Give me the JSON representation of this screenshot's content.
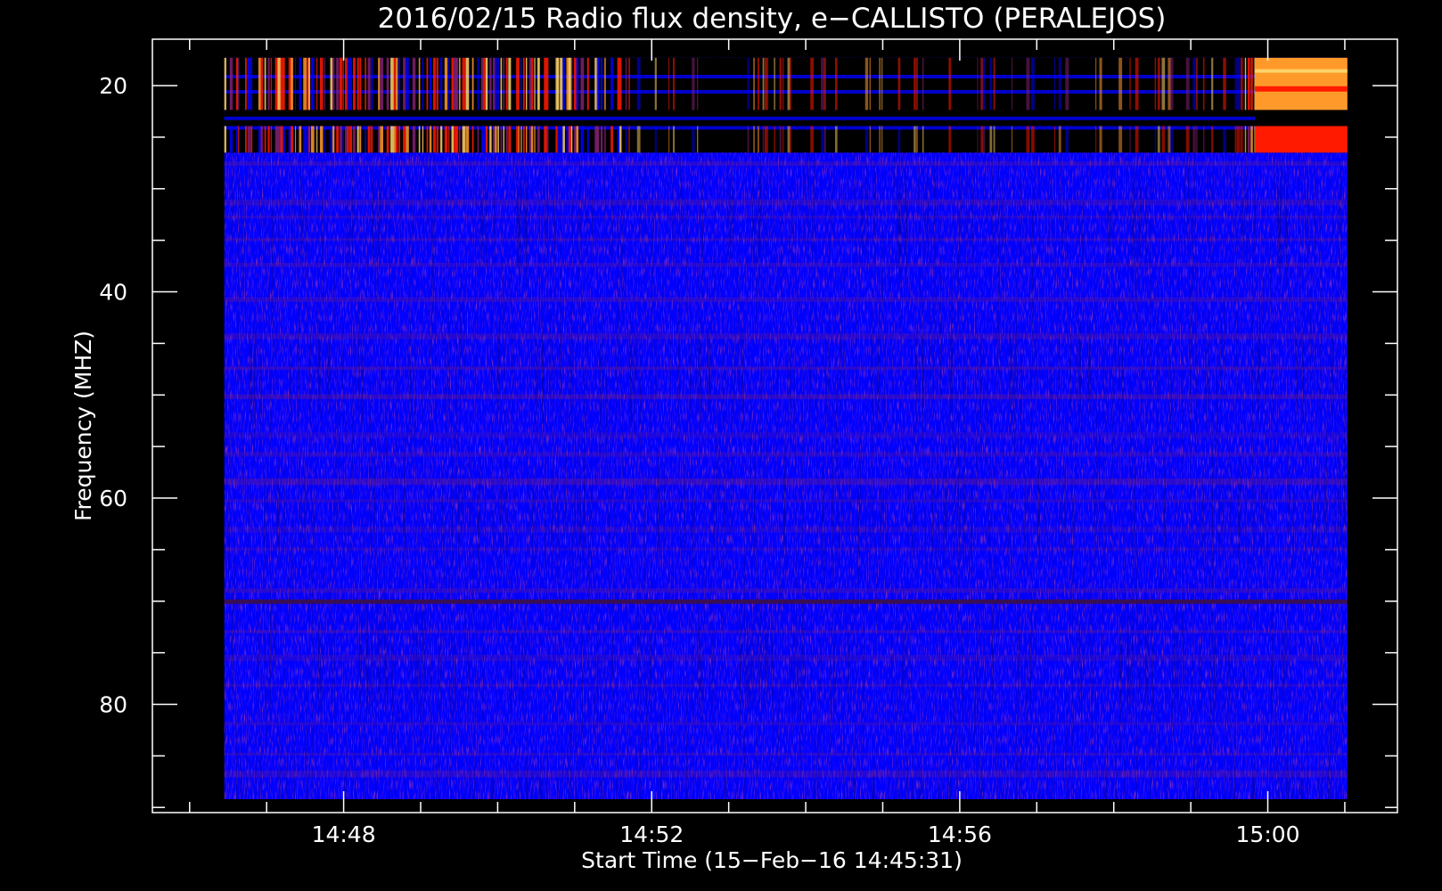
{
  "chart_data": {
    "type": "heatmap",
    "title": "2016/02/15  Radio flux density, e−CALLISTO (PERALEJOS)",
    "xlabel": "Start Time (15−Feb−16 14:45:31)",
    "ylabel": "Frequency (MHZ)",
    "x_axis": {
      "type": "time",
      "range": [
        "14:45:31",
        "15:01:41"
      ],
      "ticks": [
        "14:48",
        "14:52",
        "14:56",
        "15:00"
      ],
      "data_range": [
        "14:46:27",
        "15:01:02"
      ]
    },
    "y_axis": {
      "range": [
        15.5,
        90.5
      ],
      "inverted": true,
      "ticks": [
        20,
        40,
        60,
        80
      ],
      "minor_step": 5,
      "data_range": [
        17.3,
        89.2
      ]
    },
    "colormap": [
      "#000000",
      "#0000ff",
      "#7f2070",
      "#ff1a00",
      "#ff9a2a",
      "#ffd36a"
    ],
    "background_level": "blue",
    "features": [
      {
        "kind": "intense_band",
        "freq_range": [
          17.3,
          26.5
        ],
        "description_level": "red-orange bursts"
      },
      {
        "kind": "quiet_gap",
        "time_range": [
          "14:51:40",
          "14:59:40"
        ],
        "freq_range": [
          17.3,
          26.5
        ]
      },
      {
        "kind": "saturated_block",
        "time_range": [
          "14:59:50",
          "15:01:02"
        ],
        "freq_range": [
          17.3,
          26.5
        ]
      },
      {
        "kind": "horizontal_line",
        "freq": 70
      }
    ],
    "grid": false,
    "legend": "none"
  }
}
